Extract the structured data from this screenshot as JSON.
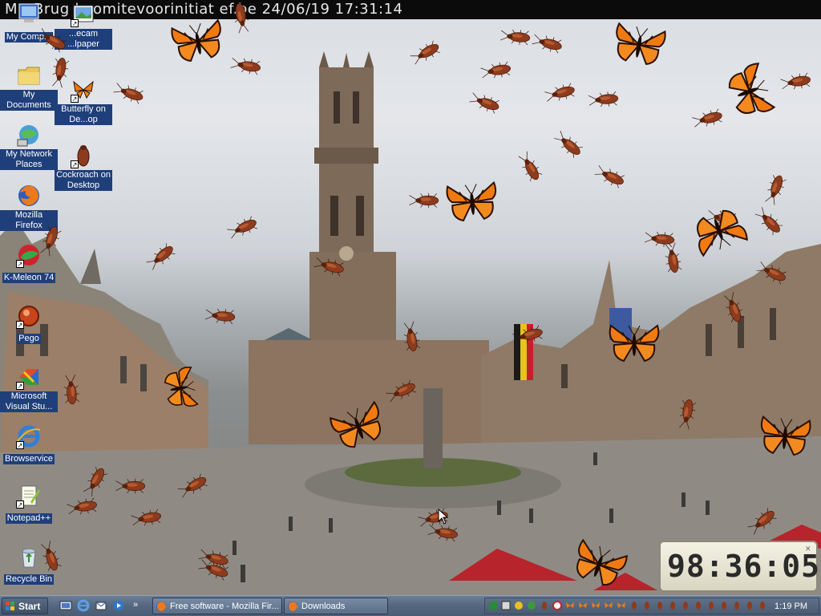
{
  "webcam": {
    "title": "M    t Brug    |  comitevoorinitiat    ef.be  24/06/19 17:31:14"
  },
  "desktop_icons": [
    {
      "key": "my-computer",
      "label": "My Comp..."
    },
    {
      "key": "webcam-wallpaper",
      "label": "...ecam ...lpaper"
    },
    {
      "key": "my-documents",
      "label": "My Documents"
    },
    {
      "key": "butterfly-on-desktop",
      "label": "Butterfly on De...op"
    },
    {
      "key": "my-network-places",
      "label": "My Network Places"
    },
    {
      "key": "cockroach-on-desktop",
      "label": "Cockroach on Desktop"
    },
    {
      "key": "mozilla-firefox",
      "label": "Mozilla Firefox"
    },
    {
      "key": "k-meleon",
      "label": "K-Meleon 74"
    },
    {
      "key": "pego",
      "label": "Pego"
    },
    {
      "key": "visual-studio",
      "label": "Microsoft Visual Stu..."
    },
    {
      "key": "browservice",
      "label": "Browservice"
    },
    {
      "key": "notepad-plus-plus",
      "label": "Notepad++"
    },
    {
      "key": "recycle-bin",
      "label": "Recycle Bin"
    }
  ],
  "clock": {
    "time": "98:36:05"
  },
  "taskbar": {
    "start_label": "Start",
    "tasks": [
      {
        "label": "Free software - Mozilla Fir...",
        "icon": "firefox-icon"
      },
      {
        "label": "Downloads",
        "icon": "folder-icon"
      }
    ],
    "tray_time": "1:19 PM"
  },
  "colors": {
    "taskbar": "#54677f",
    "icon_label_bg": "#1f3f7a",
    "butterfly": "#f07a12",
    "cockroach": "#8a3a1c"
  }
}
